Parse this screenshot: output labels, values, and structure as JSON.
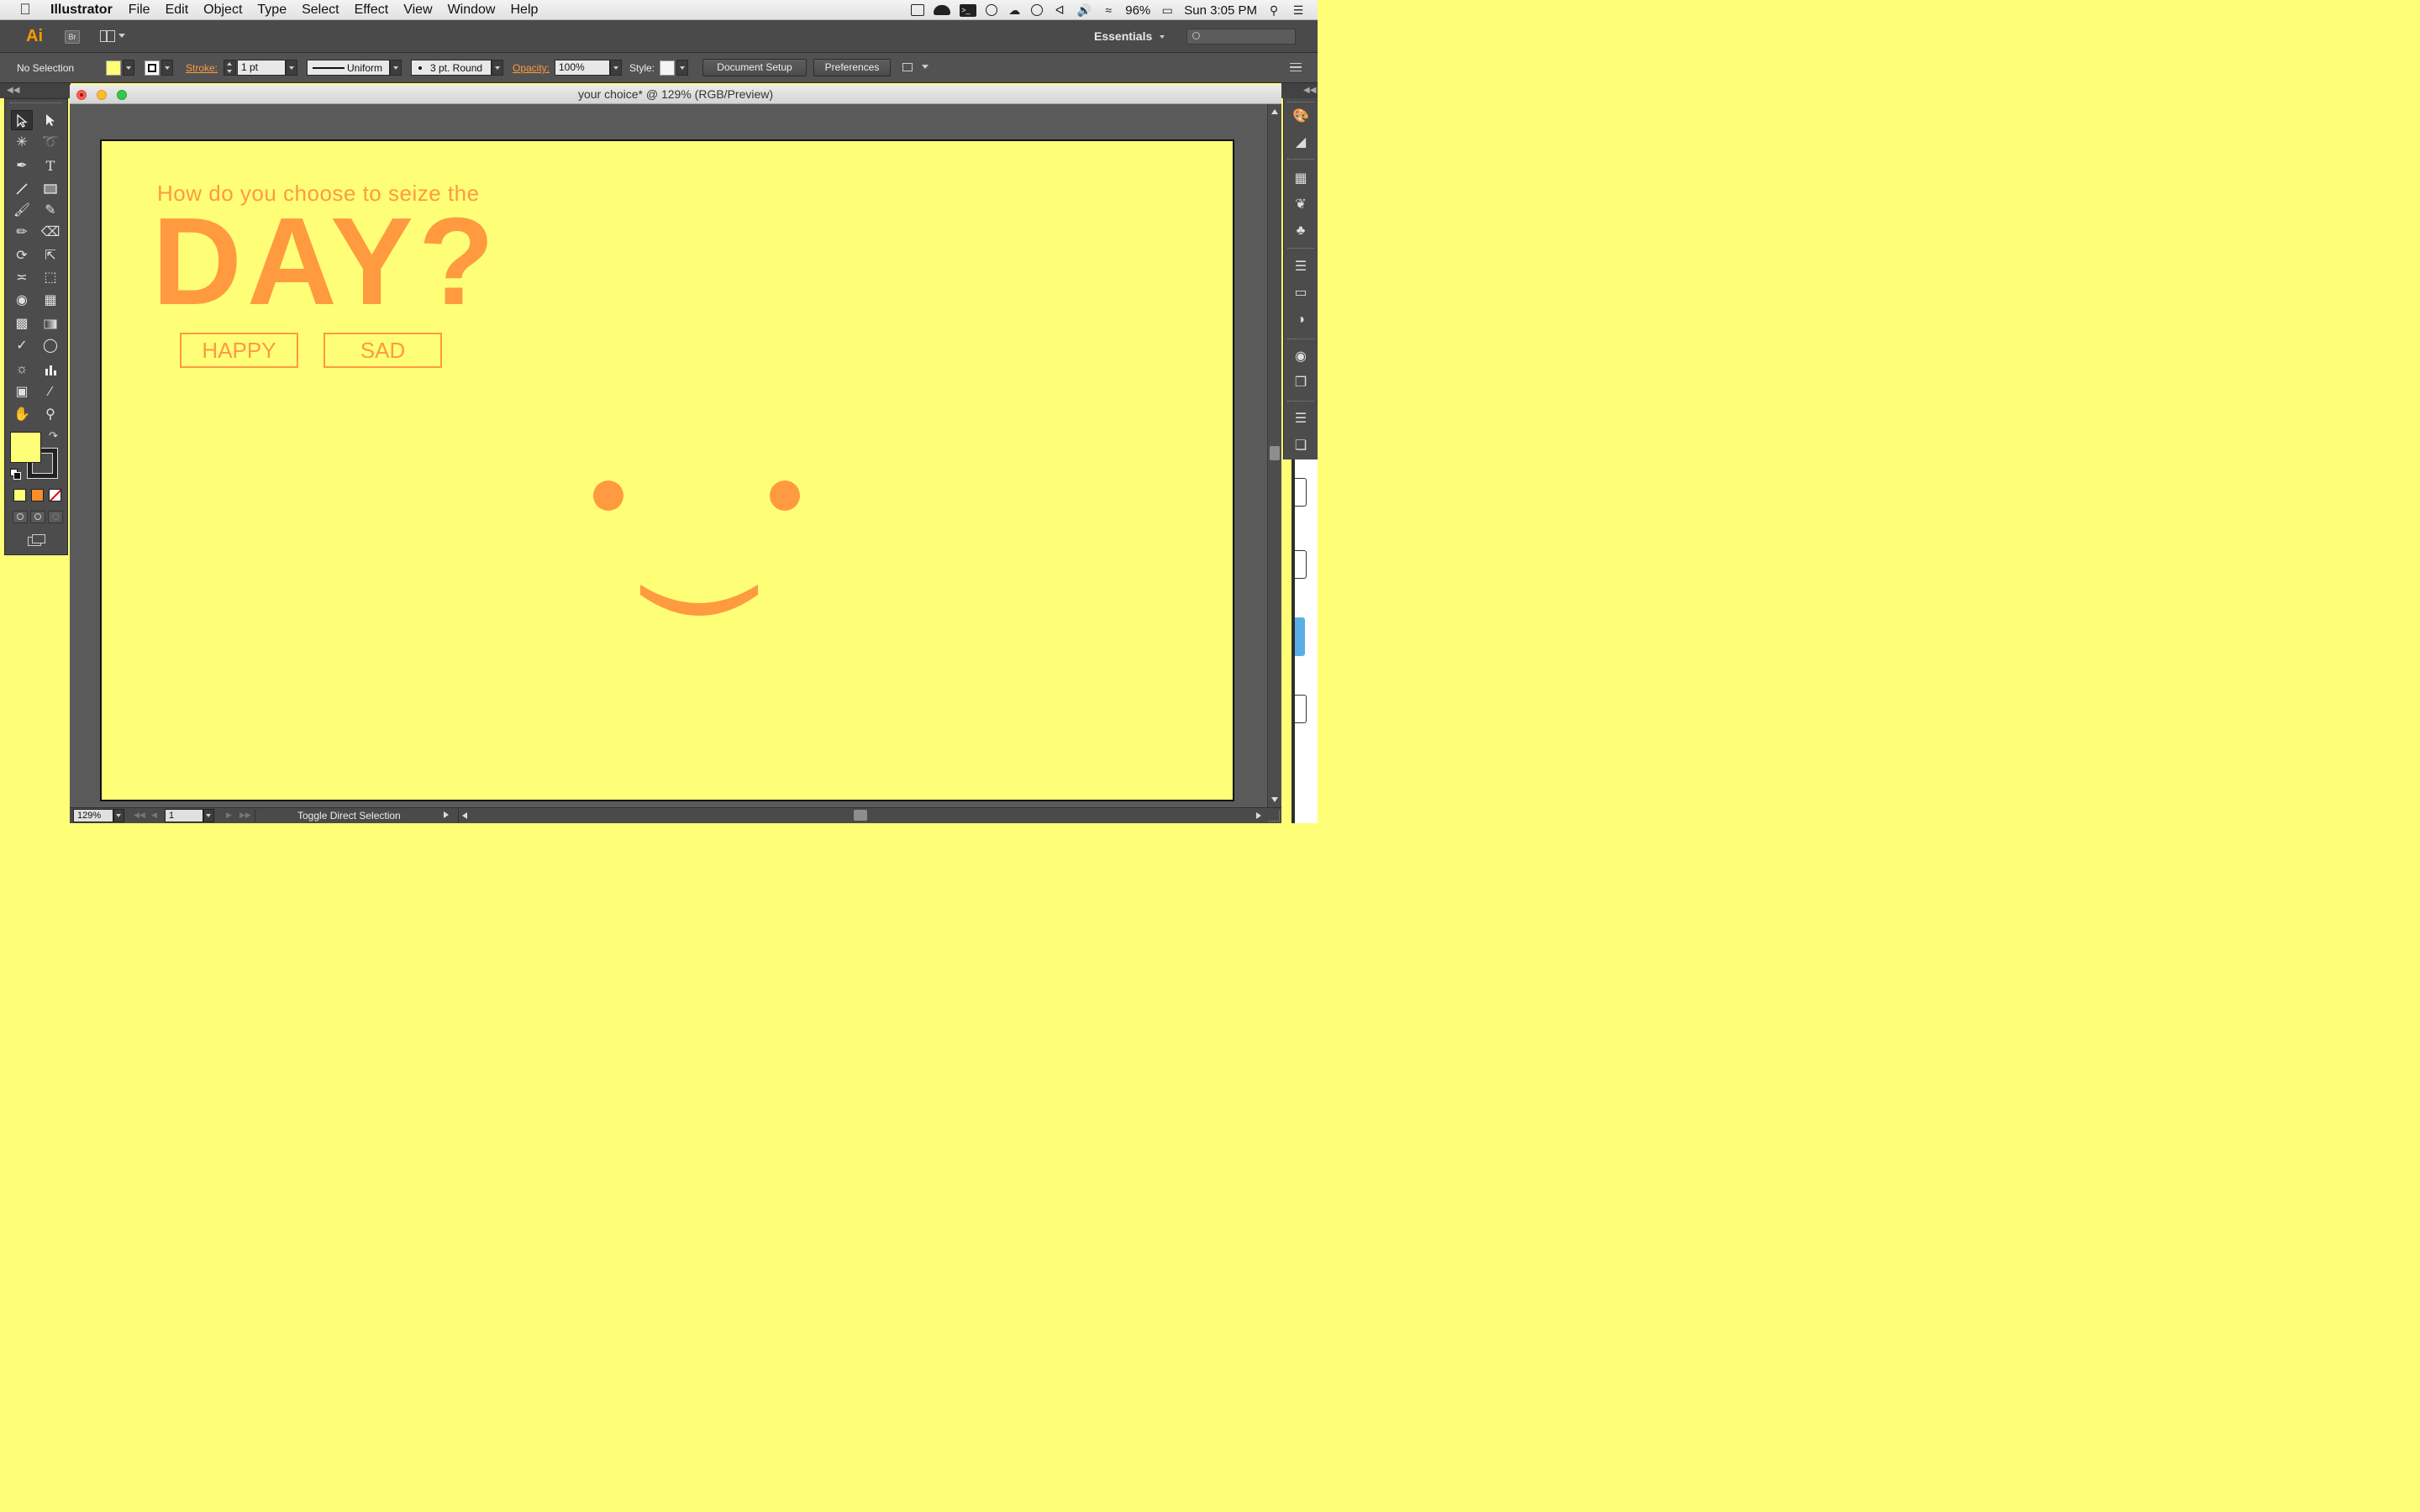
{
  "menubar": {
    "app_name": "Illustrator",
    "items": [
      "File",
      "Edit",
      "Object",
      "Type",
      "Select",
      "Effect",
      "View",
      "Window",
      "Help"
    ],
    "battery": "96%",
    "clock": "Sun 3:05 PM"
  },
  "appbar": {
    "ai_logo": "Ai",
    "bridge_logo": "Br",
    "workspace": "Essentials"
  },
  "controlbar": {
    "selection": "No Selection",
    "stroke_label": "Stroke:",
    "stroke_weight": "1 pt",
    "profile": "Uniform",
    "brush": "3 pt. Round",
    "opacity_label": "Opacity:",
    "opacity": "100%",
    "style_label": "Style:",
    "document_setup": "Document Setup",
    "preferences": "Preferences"
  },
  "tools": {
    "colors": {
      "fill": "#ffff77",
      "stroke": "#111111"
    }
  },
  "document": {
    "title": "your choice* @ 129% (RGB/Preview)",
    "zoom": "129%",
    "page": "1",
    "status": "Toggle Direct Selection"
  },
  "artwork": {
    "question": "How do you choose to seize the",
    "headline": "DAY?",
    "happy_label": "HAPPY",
    "sad_label": "SAD",
    "colors": {
      "background": "#ffff77",
      "accent": "#ff9a40"
    }
  }
}
